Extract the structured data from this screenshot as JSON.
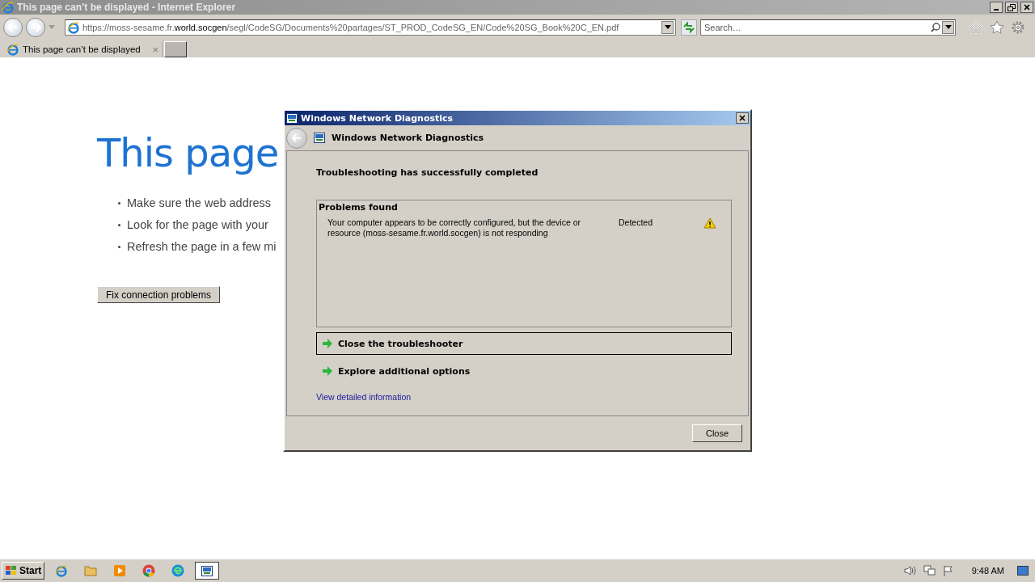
{
  "browser": {
    "title": "This page can’t be displayed - Internet Explorer",
    "address": "https://moss-sesame.fr.**world.socgen**/segl/CodeSG/Documents%20partages/ST_PROD_CodeSG_EN/Code%20SG_Book%20C_EN.pdf",
    "search": {
      "placeholder": "Search…"
    },
    "tabs": [
      {
        "label": "This page can’t be displayed",
        "close": "×",
        "selected": true
      }
    ]
  },
  "page": {
    "heading": "This page",
    "bullets": [
      "Make sure the web address",
      "Look for the page with your",
      "Refresh the page in a few mi"
    ],
    "button": "Fix connection problems"
  },
  "dialog": {
    "title": "Windows Network Diagnostics",
    "header": "Windows Network Diagnostics",
    "status": "Troubleshooting has successfully completed",
    "problems": {
      "heading": "Problems found",
      "rows": [
        {
          "description": "Your computer appears to be correctly configured, but the device or resource (moss-sesame.fr.world.socgen) is not responding",
          "status": "Detected"
        }
      ]
    },
    "options": [
      {
        "label": "Close the troubleshooter",
        "selected": true
      },
      {
        "label": "Explore additional options",
        "selected": false
      }
    ],
    "link": "View detailed information",
    "close_button": "Close"
  },
  "taskbar": {
    "start": "Start",
    "apps": [
      {
        "kind": "ie",
        "selected": false
      },
      {
        "kind": "folder",
        "selected": false
      },
      {
        "kind": "media",
        "selected": false
      },
      {
        "kind": "chrome",
        "selected": false
      },
      {
        "kind": "edge",
        "selected": false
      },
      {
        "kind": "diagnostics",
        "selected": true
      }
    ],
    "clock": "9:48 AM"
  }
}
